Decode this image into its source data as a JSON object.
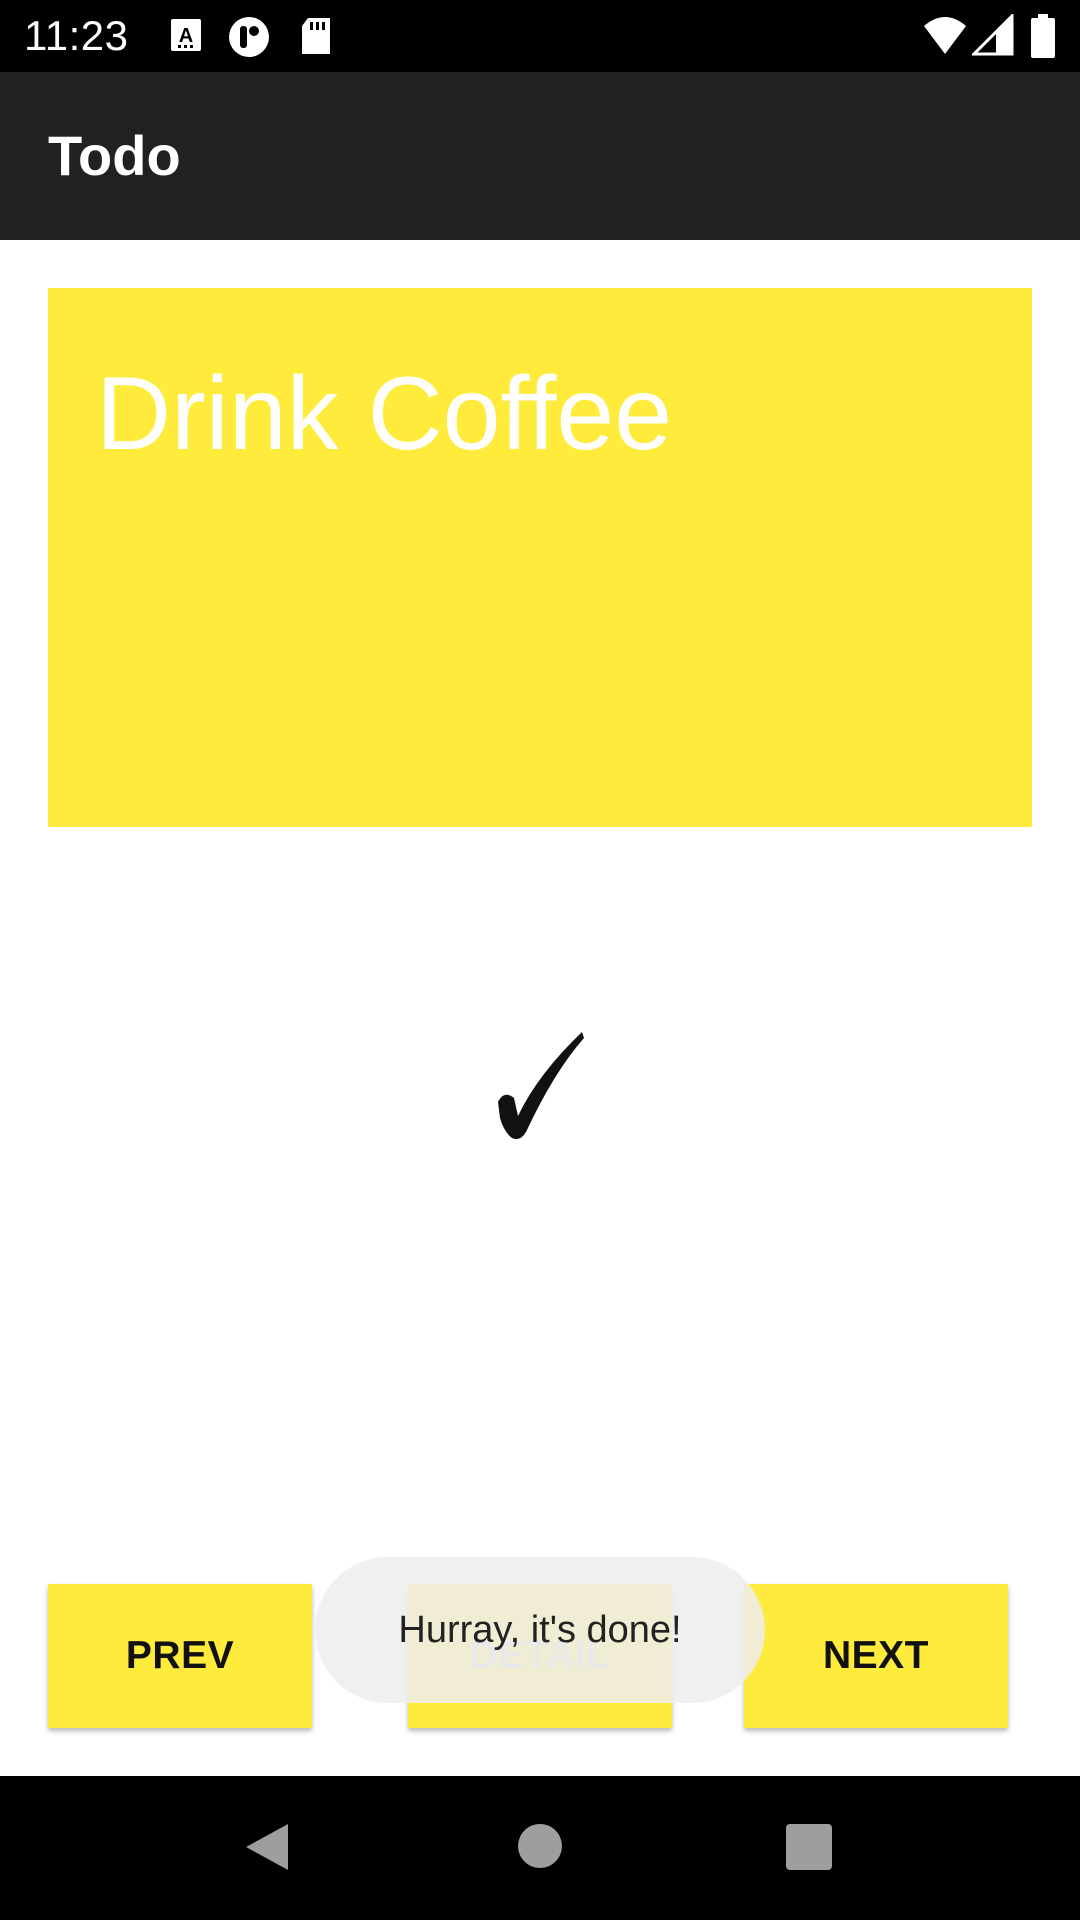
{
  "status_bar": {
    "time": "11:23",
    "notification_icons": [
      "text-a-icon",
      "circle-app-icon",
      "sd-card-icon"
    ],
    "system_icons": [
      "wifi-icon",
      "signal-icon",
      "battery-icon"
    ]
  },
  "app_bar": {
    "title": "Todo"
  },
  "todo": {
    "title": "Drink Coffee",
    "card_color": "#ffeb3b",
    "done_mark": "check-mark-icon"
  },
  "buttons": {
    "prev_label": "PREV",
    "detail_label": "DETAIL",
    "next_label": "NEXT"
  },
  "toast": {
    "message": "Hurray, it's done!"
  },
  "nav_bar": {
    "icons": [
      "back-icon",
      "home-icon",
      "recents-icon"
    ]
  }
}
